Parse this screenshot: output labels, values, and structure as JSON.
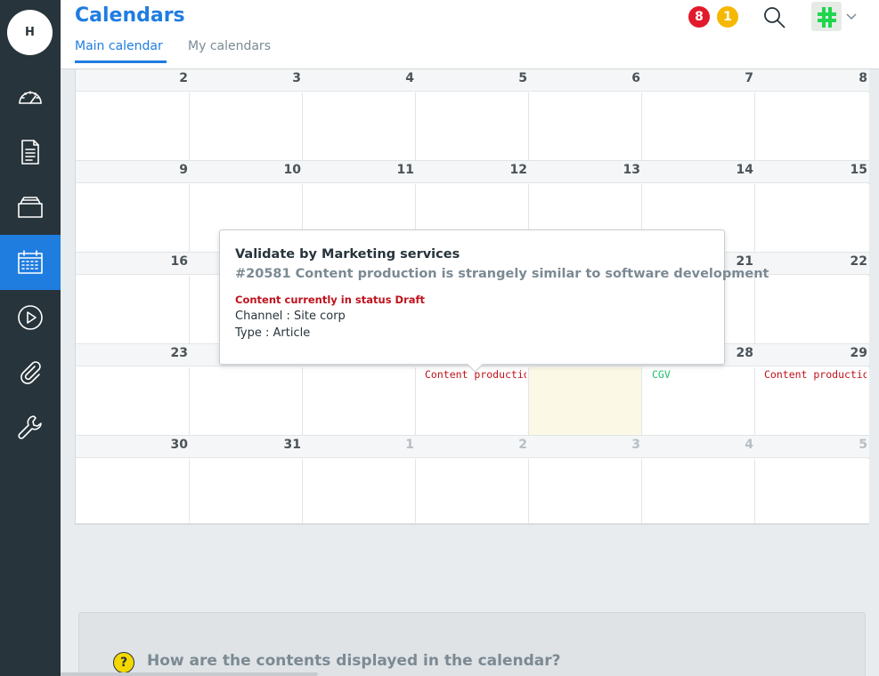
{
  "user": {
    "avatar_initial": "H"
  },
  "header": {
    "title": "Calendars",
    "tabs": [
      {
        "label": "Main calendar",
        "active": true
      },
      {
        "label": "My calendars",
        "active": false
      }
    ],
    "badges": {
      "red_count": "8",
      "yellow_count": "1"
    }
  },
  "sidebar": {
    "items": [
      {
        "icon": "dashboard-icon"
      },
      {
        "icon": "document-icon"
      },
      {
        "icon": "folder-icon"
      },
      {
        "icon": "calendar-icon",
        "active": true
      },
      {
        "icon": "play-icon"
      },
      {
        "icon": "paperclip-icon"
      },
      {
        "icon": "wrench-icon"
      }
    ]
  },
  "calendar": {
    "weeks": [
      {
        "days": [
          "2",
          "3",
          "4",
          "5",
          "6",
          "7",
          "8"
        ],
        "muted": [
          false,
          false,
          false,
          false,
          false,
          false,
          false
        ]
      },
      {
        "days": [
          "9",
          "10",
          "11",
          "12",
          "13",
          "14",
          "15"
        ],
        "muted": [
          false,
          false,
          false,
          false,
          false,
          false,
          false
        ]
      },
      {
        "days": [
          "16",
          "",
          "",
          "",
          "",
          "21",
          "22"
        ],
        "muted": [
          false,
          false,
          false,
          false,
          false,
          false,
          false
        ]
      },
      {
        "days": [
          "23",
          "",
          "",
          "",
          "",
          "28",
          "29"
        ],
        "muted": [
          false,
          false,
          false,
          false,
          false,
          false,
          false
        ]
      },
      {
        "days": [
          "30",
          "31",
          "1",
          "2",
          "3",
          "4",
          "5"
        ],
        "muted": [
          false,
          false,
          true,
          true,
          true,
          true,
          true
        ]
      }
    ],
    "events": [
      {
        "label": "Content production i",
        "color": "red"
      },
      {
        "label": "CGV",
        "color": "green"
      },
      {
        "label": "Content production i",
        "color": "red"
      }
    ]
  },
  "tooltip": {
    "title": "Validate by Marketing services",
    "subtitle": "#20581 Content production is strangely similar to software development",
    "status": "Content currently in status Draft",
    "channel": "Channel : Site corp",
    "type": "Type : Article"
  },
  "help": {
    "question": "How are the contents displayed in the calendar?",
    "icon_glyph": "?"
  },
  "colors": {
    "accent": "#1f7de0",
    "sidebar": "#27343b",
    "event_red": "#c0121c",
    "event_green": "#1fbf6a",
    "today": "#fbf8e6"
  }
}
